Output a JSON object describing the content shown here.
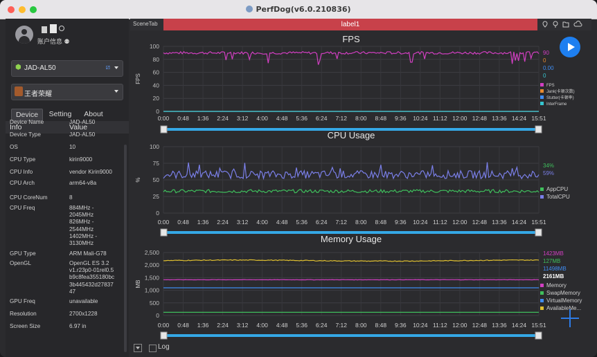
{
  "window": {
    "title": "PerfDog(v6.0.210836)"
  },
  "account": {
    "label": "账户信息"
  },
  "device_select": {
    "value": "JAD-AL50"
  },
  "app_select": {
    "value": "王者荣耀"
  },
  "tabs": [
    "Device",
    "Setting",
    "About"
  ],
  "info_table": {
    "headers": [
      "Info",
      "Value"
    ],
    "rows": [
      {
        "key": "Device Name",
        "value": "JAD-AL50"
      },
      {
        "key": "Device Type",
        "value": "JAD-AL50"
      },
      {
        "key": "OS",
        "value": "10"
      },
      {
        "key": "CPU Type",
        "value": "kirin9000"
      },
      {
        "key": "CPU Info",
        "value": "vendor Kirin9000"
      },
      {
        "key": "CPU Arch",
        "value": "arm64-v8a"
      },
      {
        "key": "CPU CoreNum",
        "value": "8"
      },
      {
        "key": "CPU Freq",
        "value": "884MHz -\n2045MHz\n826MHz -\n2544MHz\n1402MHz -\n3130MHz"
      },
      {
        "key": "GPU Type",
        "value": "ARM Mali-G78"
      },
      {
        "key": "OpenGL",
        "value": "OpenGL ES 3.2\nv1.r23p0-01rel0.5\nb9c8fea355180bc\n3b445432d27837\n47"
      },
      {
        "key": "GPU Freq",
        "value": "unavailable"
      },
      {
        "key": "Resolution",
        "value": "2700x1228"
      },
      {
        "key": "Screen Size",
        "value": "6.97 in"
      }
    ]
  },
  "scene_tab": "SceneTab",
  "label_bar": "label1",
  "log_label": "Log",
  "time_ticks": [
    "0:00",
    "0:48",
    "1:36",
    "2:24",
    "3:12",
    "4:00",
    "4:48",
    "5:36",
    "6:24",
    "7:12",
    "8:00",
    "8:48",
    "9:36",
    "10:24",
    "11:12",
    "12:00",
    "12:48",
    "13:36",
    "14:24",
    "15:51"
  ],
  "colors": {
    "accent": "#1e7ff0",
    "label_bar": "#c8414a",
    "slider": "#35a8e6"
  },
  "chart_data": [
    {
      "type": "line",
      "title": "FPS",
      "ylabel": "FPS",
      "ylim": [
        0,
        100
      ],
      "yticks": [
        0,
        20,
        40,
        60,
        80,
        100
      ],
      "current_values": [
        "90",
        "0",
        "0.00",
        "0"
      ],
      "series": [
        {
          "name": "FPS",
          "color": "#d23fc2",
          "approx": 90
        },
        {
          "name": "Jank(卡顿次数)",
          "color": "#e98a2e",
          "approx": 0
        },
        {
          "name": "Stutter(卡顿率)",
          "color": "#3f8df2",
          "approx": 0
        },
        {
          "name": "InterFrame",
          "color": "#36c5cf",
          "approx": 0
        }
      ]
    },
    {
      "type": "line",
      "title": "CPU Usage",
      "ylabel": "%",
      "ylim": [
        0,
        100
      ],
      "yticks": [
        0,
        25,
        50,
        75,
        100
      ],
      "current_values": [
        "34%",
        "59%"
      ],
      "series": [
        {
          "name": "AppCPU",
          "color": "#3fbf5c",
          "approx": 33
        },
        {
          "name": "TotalCPU",
          "color": "#7a7fe8",
          "approx": 58
        }
      ]
    },
    {
      "type": "line",
      "title": "Memory Usage",
      "ylabel": "MB",
      "ylim": [
        0,
        2500
      ],
      "yticks": [
        0,
        500,
        1000,
        1500,
        2000,
        2500
      ],
      "current_values": [
        "1423MB",
        "127MB",
        "11498MB",
        "2161MB"
      ],
      "series": [
        {
          "name": "Memory",
          "color": "#d23fc2",
          "approx": 1420
        },
        {
          "name": "SwapMemory",
          "color": "#3fbf5c",
          "approx": 127
        },
        {
          "name": "VirtualMemory",
          "color": "#3f8df2",
          "approx": 1100
        },
        {
          "name": "AvailableMe...",
          "color": "#e0c030",
          "approx": 2180
        }
      ]
    }
  ]
}
